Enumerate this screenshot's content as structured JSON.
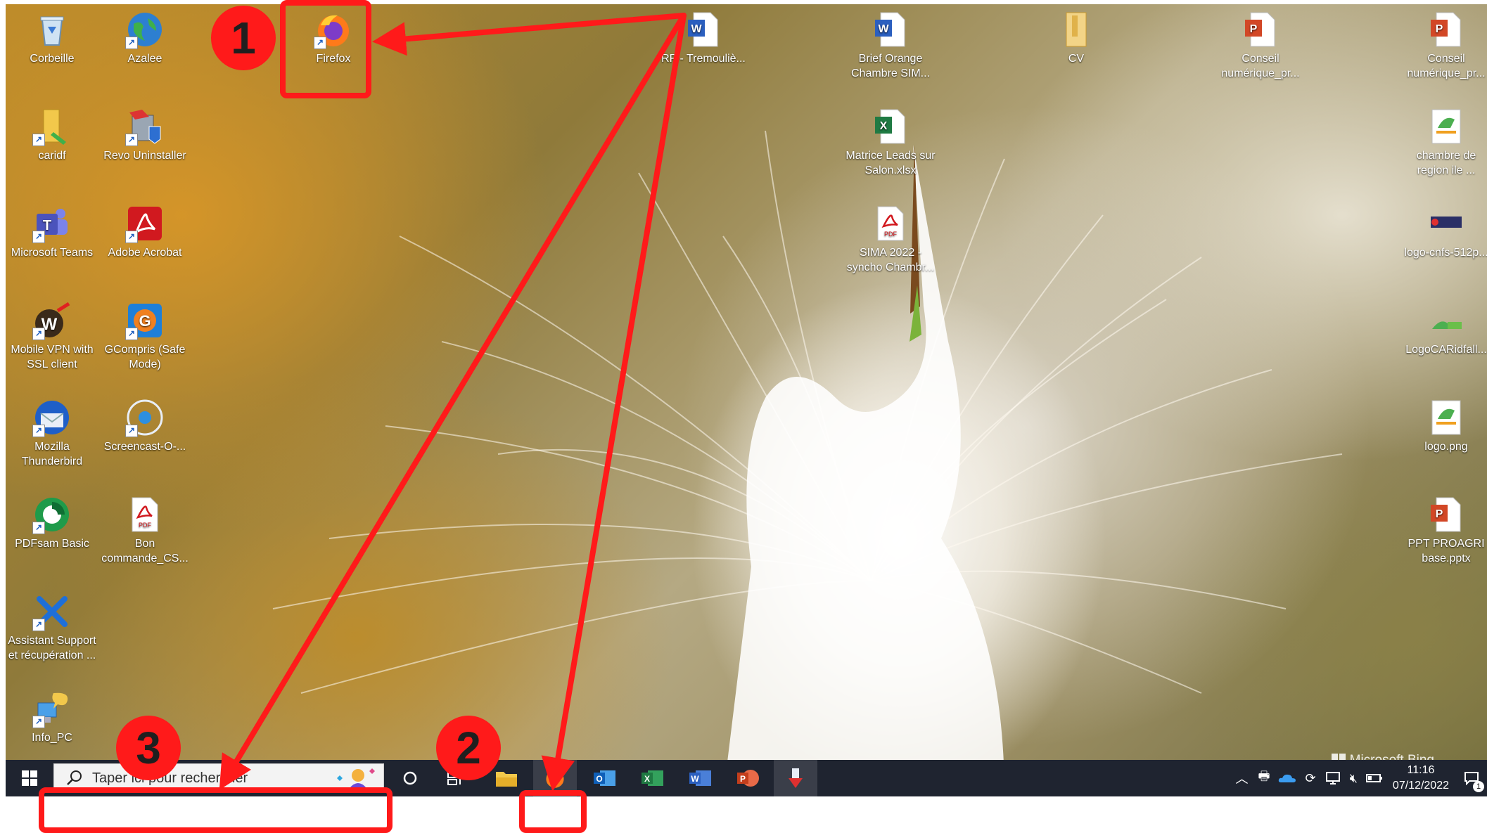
{
  "desktop": {
    "icons_left": [
      {
        "label": "Corbeille",
        "icon": "recycle-bin-icon"
      },
      {
        "label": "Azalee",
        "icon": "globe-icon"
      },
      {
        "label": "Firefox",
        "icon": "firefox-icon"
      },
      {
        "label": "caridf",
        "icon": "folder-icon"
      },
      {
        "label": "Revo Uninstaller",
        "icon": "revo-uninstaller-icon"
      },
      {
        "label": "Microsoft Teams",
        "icon": "teams-icon"
      },
      {
        "label": "Adobe Acrobat",
        "icon": "acrobat-icon"
      },
      {
        "label": "Mobile VPN with SSL client",
        "icon": "vpn-icon"
      },
      {
        "label": "GCompris (Safe Mode)",
        "icon": "gcompris-icon"
      },
      {
        "label": "Mozilla Thunderbird",
        "icon": "thunderbird-icon"
      },
      {
        "label": "Screencast-O-...",
        "icon": "screencast-icon"
      },
      {
        "label": "PDFsam Basic",
        "icon": "pdfsam-icon"
      },
      {
        "label": "Bon commande_CS...",
        "icon": "pdf-file-icon"
      },
      {
        "label": "Assistant Support et récupération ...",
        "icon": "support-assistant-icon"
      },
      {
        "label": "Info_PC",
        "icon": "info-pc-icon"
      }
    ],
    "icons_middle": [
      {
        "label": "RP - Tremouliè...",
        "icon": "word-file-icon"
      },
      {
        "label": "Brief Orange Chambre SIM...",
        "icon": "word-file-icon"
      },
      {
        "label": "Matrice Leads sur Salon.xlsx",
        "icon": "excel-file-icon"
      },
      {
        "label": "SIMA 2022 - syncho Chambr...",
        "icon": "pdf-file-icon"
      },
      {
        "label": "CV",
        "icon": "zip-folder-icon"
      }
    ],
    "icons_right": [
      {
        "label": "Conseil numérique_pr...",
        "icon": "powerpoint-file-icon"
      },
      {
        "label": "Conseil numérique_pr...",
        "icon": "powerpoint-file-icon"
      },
      {
        "label": "chambre de region ile ...",
        "icon": "image-file-icon"
      },
      {
        "label": "logo-cnfs-512p...",
        "icon": "image-file-icon"
      },
      {
        "label": "LogoCARidfall...",
        "icon": "image-file-icon"
      },
      {
        "label": "logo.png",
        "icon": "image-file-icon"
      },
      {
        "label": "PPT PROAGRI base.pptx",
        "icon": "powerpoint-file-icon"
      }
    ],
    "watermark": "Microsoft Bing"
  },
  "taskbar": {
    "search_placeholder": "Taper ici pour rechercher",
    "apps": [
      "start-icon",
      "cortana-icon",
      "task-view-icon",
      "file-explorer-icon",
      "firefox-icon",
      "outlook-icon",
      "excel-icon",
      "word-icon",
      "powerpoint-icon",
      "app-icon"
    ],
    "clock_time": "11:16",
    "clock_date": "07/12/2022",
    "notification_count": "1"
  },
  "annotations": {
    "badges": [
      "1",
      "2",
      "3"
    ],
    "color": "#ff1a1a"
  }
}
